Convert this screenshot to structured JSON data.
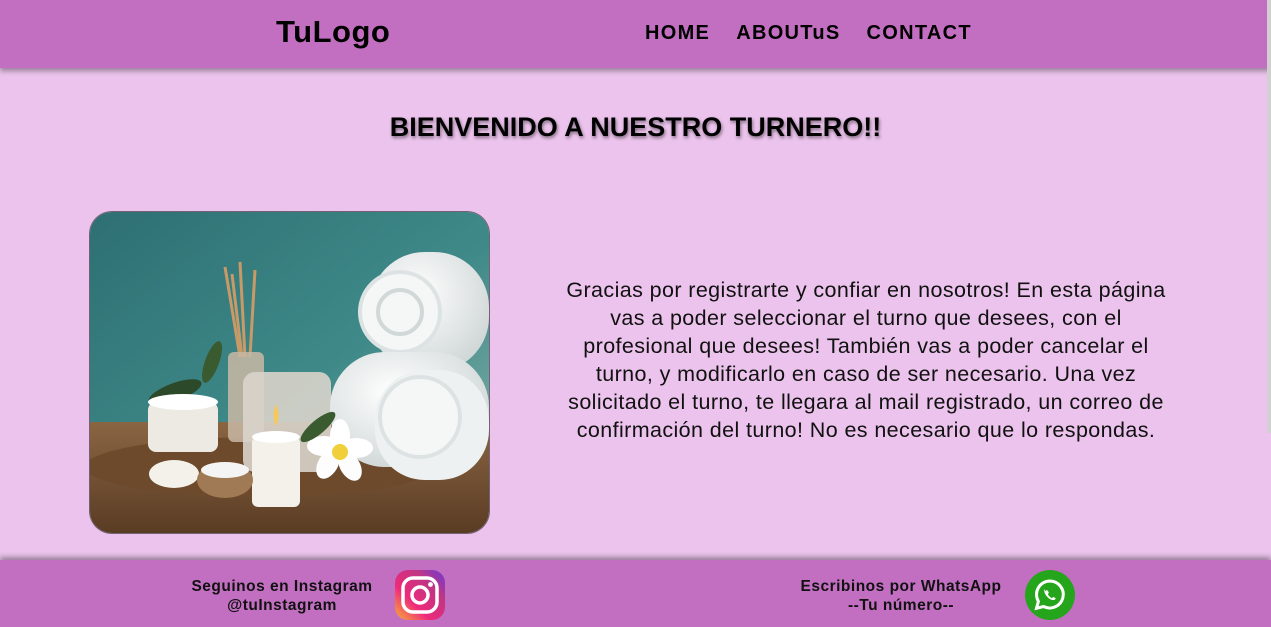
{
  "header": {
    "logo": "TuLogo",
    "nav": [
      {
        "label": "HOME"
      },
      {
        "label": "ABOUTuS"
      },
      {
        "label": "CONTACT"
      }
    ]
  },
  "main": {
    "title": "BIENVENIDO A NUESTRO TURNERO!!",
    "message": "Gracias por registrarte y confiar en nosotros! En esta página vas a poder seleccionar el turno que desees, con el profesional que desees! También vas a poder cancelar el turno, y modificarlo en caso de ser necesario. Una vez solicitado el turno, te llegara al mail registrado, un correo de confirmación del turno! No es necesario que lo respondas.",
    "image_icon": "spa-towels-candles-photo"
  },
  "footer": {
    "instagram": {
      "line1": "Seguinos en Instagram",
      "line2": "@tuInstagram",
      "icon": "instagram-icon"
    },
    "whatsapp": {
      "line1": "Escribinos por WhatsApp",
      "line2": "--Tu número--",
      "icon": "whatsapp-icon"
    }
  },
  "colors": {
    "bar": "#c26fc1",
    "background": "#ebc3ec",
    "whatsapp_green": "#25a51b"
  }
}
